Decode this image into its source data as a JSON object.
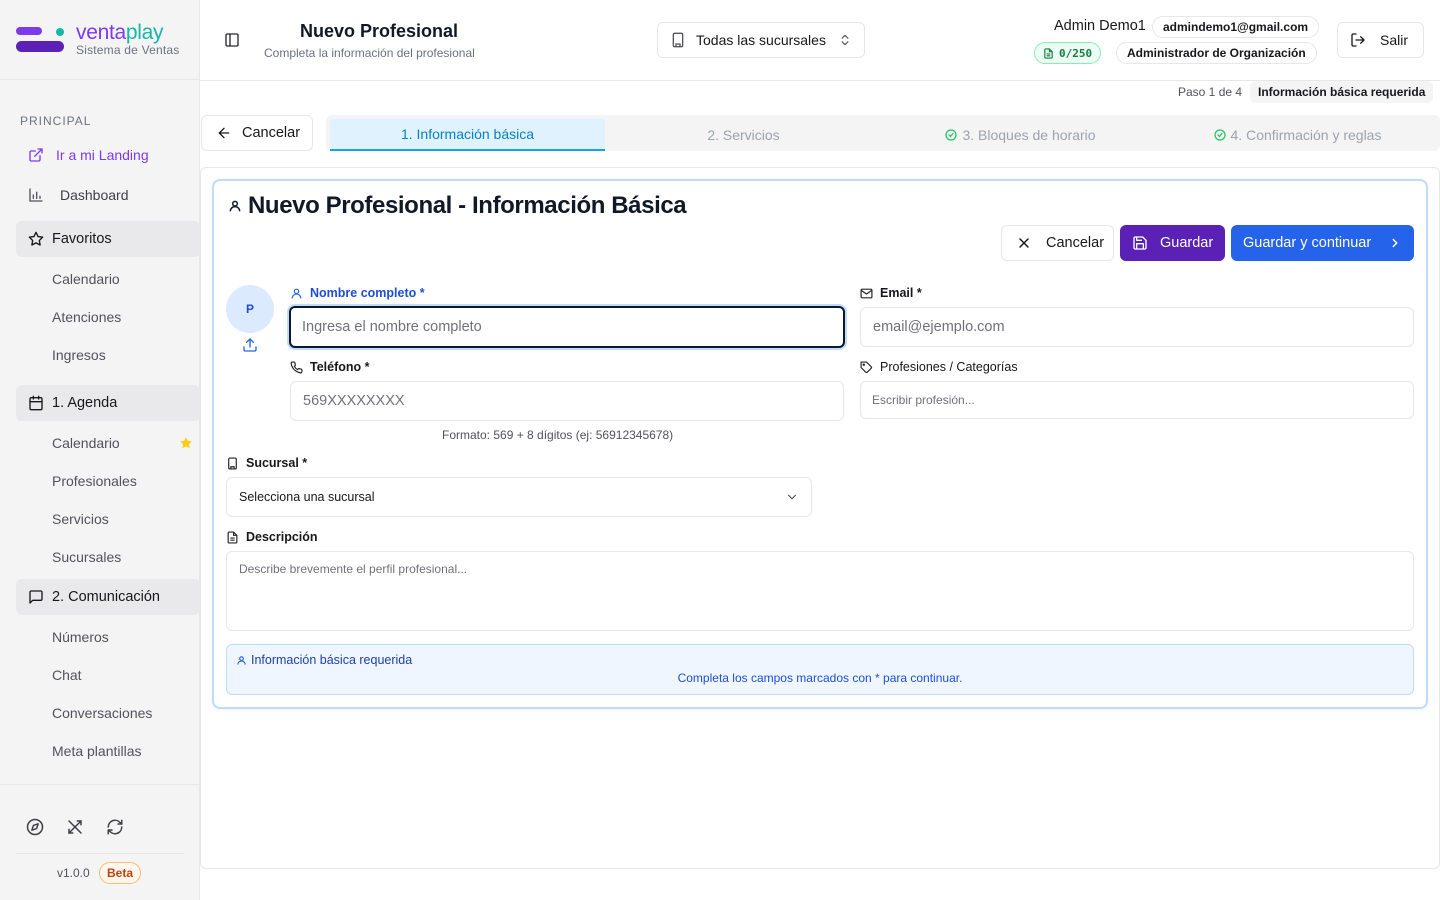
{
  "app": {
    "name_part1": "venta",
    "name_part2": "play",
    "tagline": "Sistema de Ventas",
    "colors": {
      "brand_purple": "#7c3aed",
      "brand_teal": "#14b8a6",
      "primary_blue": "#2563eb",
      "save_purple": "#5b21b6"
    }
  },
  "sidebar": {
    "section_label": "PRINCIPAL",
    "landing_link": "Ir a mi Landing",
    "dashboard": "Dashboard",
    "favorites": {
      "label": "Favoritos",
      "items": [
        "Calendario",
        "Atenciones",
        "Ingresos"
      ]
    },
    "agenda": {
      "label": "1. Agenda",
      "items": [
        "Calendario",
        "Profesionales",
        "Servicios",
        "Sucursales"
      ]
    },
    "comunicacion": {
      "label": "2. Comunicación",
      "items": [
        "Números",
        "Chat",
        "Conversaciones",
        "Meta plantillas"
      ]
    },
    "footer_icons": [
      "compass-icon",
      "tools-icon",
      "refresh-icon"
    ],
    "version": "v1.0.0",
    "beta_label": "Beta"
  },
  "header": {
    "title": "Nuevo Profesional",
    "subtitle": "Completa la información del profesional",
    "branch_selector": "Todas las sucursales",
    "user_name": "Admin Demo1",
    "user_email": "admindemo1@gmail.com",
    "quota": "0/250",
    "role": "Administrador de Organización",
    "logout": "Salir"
  },
  "progress": {
    "step_text": "Paso 1 de 4",
    "step_badge": "Información básica requerida"
  },
  "wizard": {
    "cancel_label": "Cancelar",
    "tabs": [
      {
        "label": "1. Información básica",
        "active": true
      },
      {
        "label": "2. Servicios",
        "active": false
      },
      {
        "label": "3. Bloques de horario",
        "active": false
      },
      {
        "label": "4. Confirmación y reglas",
        "active": false
      }
    ]
  },
  "form": {
    "title": "Nuevo Profesional - Información Básica",
    "buttons": {
      "cancel": "Cancelar",
      "save": "Guardar",
      "save_continue": "Guardar y continuar"
    },
    "avatar_initial": "P",
    "name": {
      "label": "Nombre completo *",
      "placeholder": "Ingresa el nombre completo"
    },
    "email": {
      "label": "Email *",
      "placeholder": "email@ejemplo.com"
    },
    "phone": {
      "label": "Teléfono *",
      "placeholder": "569XXXXXXXX",
      "hint": "Formato: 569 + 8 dígitos (ej: 56912345678)"
    },
    "professions": {
      "label": "Profesiones / Categorías",
      "placeholder": "Escribir profesión..."
    },
    "branch": {
      "label": "Sucursal *",
      "value": "Selecciona una sucursal"
    },
    "description": {
      "label": "Descripción",
      "placeholder": "Describe brevemente el perfil profesional..."
    },
    "info": {
      "title": "Información básica requerida",
      "text": "Completa los campos marcados con * para continuar."
    }
  }
}
